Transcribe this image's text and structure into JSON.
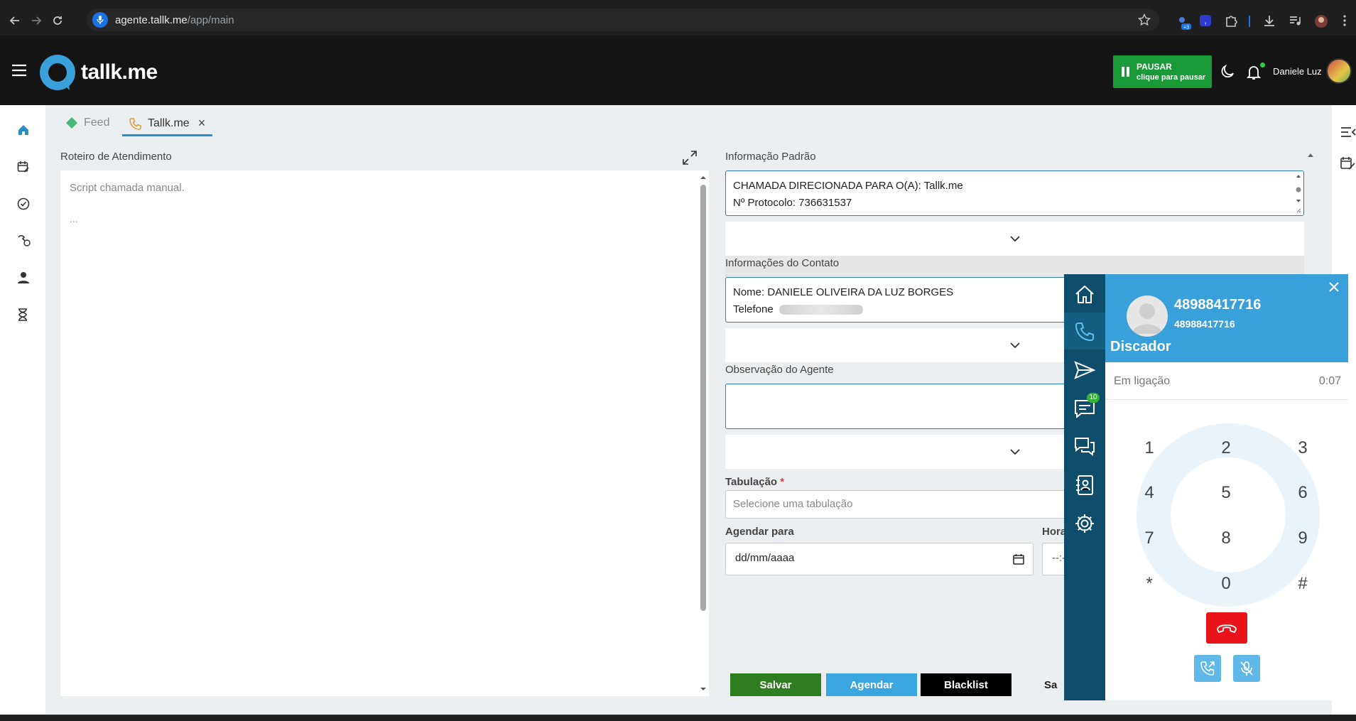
{
  "browser": {
    "url_host": "agente.tallk.me",
    "url_path": "/app/main",
    "ext_badge": "+3"
  },
  "header": {
    "logo_text": "tallk.me",
    "pause_title": "PAUSAR",
    "pause_subtitle": "clique para pausar",
    "user_name": "Daniele Luz"
  },
  "tabs": [
    {
      "label": "Feed"
    },
    {
      "label": "Tallk.me"
    }
  ],
  "script": {
    "section_label": "Roteiro de Atendimento",
    "title": "Script chamada manual.",
    "ellipsis": "..."
  },
  "info": {
    "section_label": "Informação Padrão",
    "line1": "CHAMADA DIRECIONADA PARA O(A):  Tallk.me",
    "line2": "Nº Protocolo:  736631537"
  },
  "contact": {
    "section_label": "Informações do Contato",
    "line1": "Nome: DANIELE OLIVEIRA DA LUZ BORGES",
    "line2": "Telefone"
  },
  "observation": {
    "section_label": "Observação do Agente"
  },
  "tabulation": {
    "label": "Tabulação",
    "required_mark": "*",
    "placeholder": "Selecione uma tabulação"
  },
  "schedule": {
    "date_label": "Agendar para",
    "date_value": "dd/mm/aaaa",
    "time_label": "Hora",
    "time_value": "--:-"
  },
  "buttons": {
    "save": "Salvar",
    "schedule": "Agendar",
    "blacklist": "Blacklist",
    "sa": "Sa"
  },
  "phone": {
    "number": "48988417716",
    "number_sub": "48988417716",
    "title": "Discador",
    "status": "Em ligação",
    "timer": "0:07",
    "messages_badge": "10",
    "keys": [
      "1",
      "2",
      "3",
      "4",
      "5",
      "6",
      "7",
      "8",
      "9",
      "*",
      "0",
      "#"
    ]
  },
  "colors": {
    "header_bg": "#141414",
    "pause_green": "#1a9a37",
    "accent_blue": "#3aa0da",
    "rail_blue": "#0e4d6b",
    "save_green": "#2e7d1e",
    "schedule_blue": "#3aa6e0",
    "hangup_red": "#e8141a"
  }
}
